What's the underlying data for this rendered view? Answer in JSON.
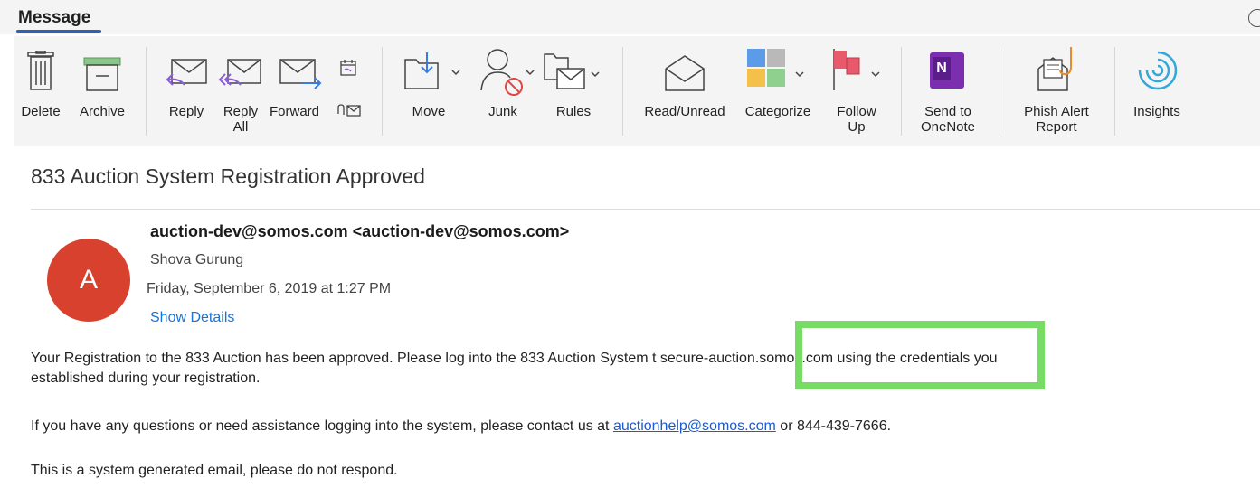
{
  "tabbar": {
    "active_tab": "Message"
  },
  "toolbar": {
    "delete": "Delete",
    "archive": "Archive",
    "reply": "Reply",
    "reply_all_1": "Reply",
    "reply_all_2": "All",
    "forward": "Forward",
    "move": "Move",
    "junk": "Junk",
    "rules": "Rules",
    "read_unread": "Read/Unread",
    "categorize": "Categorize",
    "follow_up_1": "Follow",
    "follow_up_2": "Up",
    "onenote_1": "Send to",
    "onenote_2": "OneNote",
    "phish_1": "Phish Alert",
    "phish_2": "Report",
    "insights": "Insights",
    "onenote_badge": "N"
  },
  "email": {
    "subject": "833 Auction System Registration Approved",
    "avatar_letter": "A",
    "sender": "auction-dev@somos.com <auction-dev@somos.com>",
    "recipient": "Shova Gurung",
    "date": "Friday, September 6, 2019 at 1:27 PM",
    "show_details": "Show Details",
    "p1_before": "Your Registration to the 833 Auction has been approved. Please log into the 833 Auction System ",
    "p1_hidden1": "t ",
    "p1_url": "secure-auction.somos.com",
    "p1_hidden2": " u",
    "p1_after": "sing the credentials you",
    "p1_line2": "established during your registration.",
    "p2_before": "If you have any questions or need assistance logging into the system, please contact us at ",
    "p2_link": "auctionhelp@somos.com",
    "p2_after": " or 844-439-7666.",
    "p3": "This is a system generated email, please do not respond."
  },
  "colors": {
    "accent": "#2d62b5",
    "avatar": "#d9412f",
    "highlight": "#77dc64",
    "link": "#1a73d6"
  }
}
